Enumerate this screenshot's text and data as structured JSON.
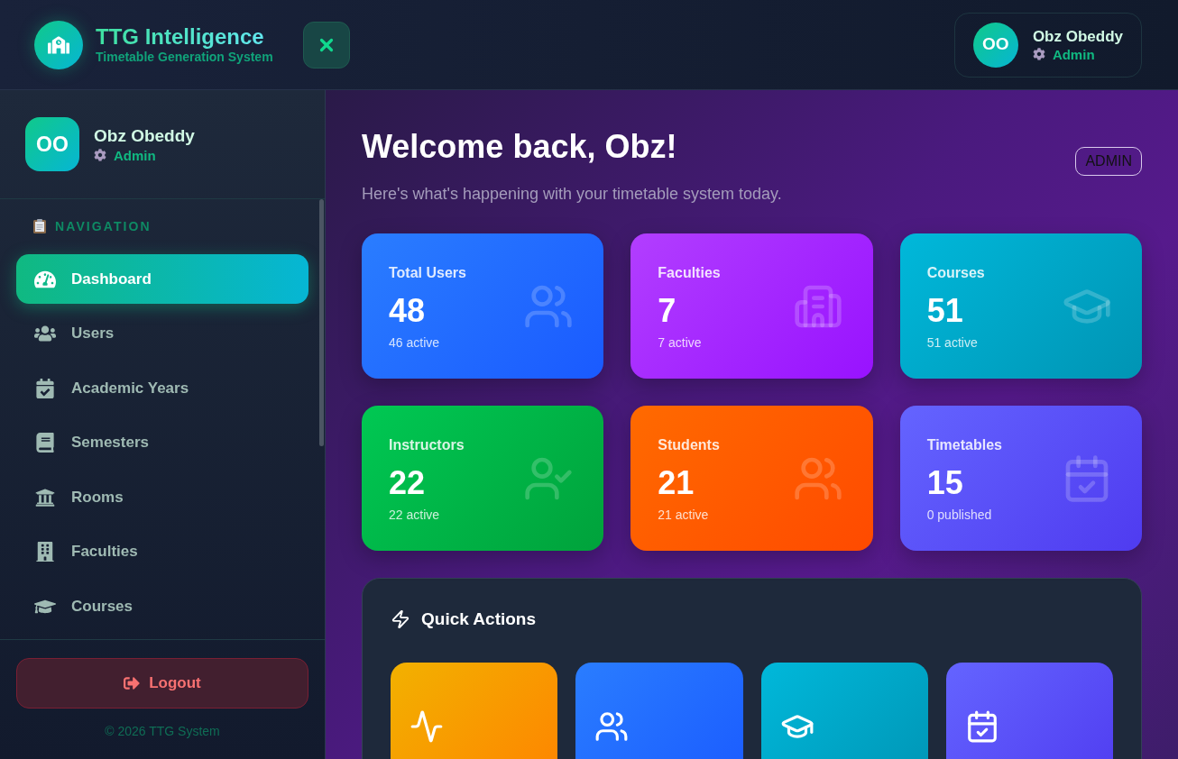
{
  "header": {
    "title": "TTG Intelligence",
    "subtitle": "Timetable Generation System",
    "user": {
      "initials": "OO",
      "name": "Obz Obeddy",
      "role": "Admin"
    }
  },
  "sidebar": {
    "user": {
      "initials": "OO",
      "name": "Obz Obeddy",
      "role": "Admin"
    },
    "section_label": "NAVIGATION",
    "items": [
      {
        "label": "Dashboard",
        "selected": true
      },
      {
        "label": "Users",
        "selected": false
      },
      {
        "label": "Academic Years",
        "selected": false
      },
      {
        "label": "Semesters",
        "selected": false
      },
      {
        "label": "Rooms",
        "selected": false
      },
      {
        "label": "Faculties",
        "selected": false
      },
      {
        "label": "Courses",
        "selected": false
      }
    ],
    "logout": "Logout",
    "footer": "© 2026 TTG System"
  },
  "main": {
    "title": "Welcome back, Obz!",
    "subtitle": "Here's what's happening with your timetable system today.",
    "badge": "ADMIN",
    "stats": [
      {
        "label": "Total Users",
        "value": "48",
        "note": "46 active"
      },
      {
        "label": "Faculties",
        "value": "7",
        "note": "7 active"
      },
      {
        "label": "Courses",
        "value": "51",
        "note": "51 active"
      },
      {
        "label": "Instructors",
        "value": "22",
        "note": "22 active"
      },
      {
        "label": "Students",
        "value": "21",
        "note": "21 active"
      },
      {
        "label": "Timetables",
        "value": "15",
        "note": "0 published"
      }
    ],
    "quick_actions": {
      "title": "Quick Actions"
    }
  }
}
